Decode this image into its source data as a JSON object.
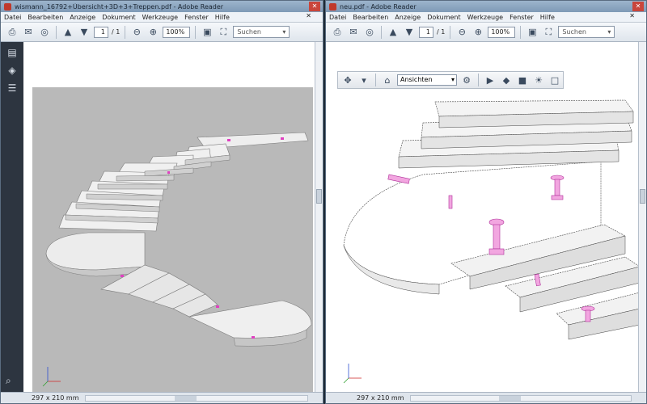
{
  "left_window": {
    "title": "wismann_16792+Übersicht+3D+3+Treppen.pdf - Adobe Reader",
    "close_glyph": "✕",
    "menu": [
      "Datei",
      "Bearbeiten",
      "Anzeige",
      "Dokument",
      "Werkzeuge",
      "Fenster",
      "Hilfe"
    ],
    "page_current": "1",
    "page_total": "/ 1",
    "zoom": "100%",
    "search_placeholder": "Suchen",
    "page_size": "297 x 210 mm",
    "background_color": "#b9b9b9"
  },
  "right_window": {
    "title": "neu.pdf - Adobe Reader",
    "close_glyph": "✕",
    "menu": [
      "Datei",
      "Bearbeiten",
      "Anzeige",
      "Dokument",
      "Werkzeuge",
      "Fenster",
      "Hilfe"
    ],
    "page_current": "1",
    "page_total": "/ 1",
    "zoom": "100%",
    "search_placeholder": "Suchen",
    "view_select": "Ansichten",
    "page_size": "297 x 210 mm"
  },
  "icons": {
    "print": "printer-icon",
    "email": "email-icon",
    "collaborate": "collaborate-icon",
    "prev_page": "up-arrow-icon",
    "next_page": "down-arrow-icon",
    "zoom_out": "zoom-out-icon",
    "zoom_in": "zoom-in-icon",
    "save": "save-icon",
    "fit": "fit-page-icon"
  },
  "colors": {
    "accent_magenta": "#e040c0",
    "stair_fill": "#eeeeee",
    "stair_edge": "#7a7a7a"
  }
}
